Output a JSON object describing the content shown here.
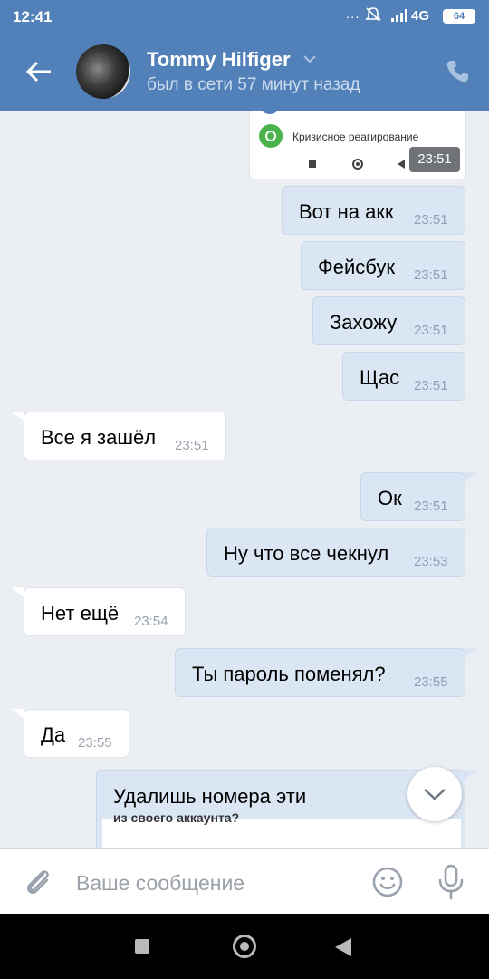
{
  "status_bar": {
    "time": "12:41",
    "dots": "...",
    "network": "4G",
    "battery": "64"
  },
  "header": {
    "contact_name": "Tommy Hilfiger",
    "last_seen": "был в сети 57 минут назад"
  },
  "attachment": {
    "label": "Кризисное реагирование",
    "time": "23:51"
  },
  "messages": [
    {
      "dir": "out",
      "text": "Вот на акк",
      "time": "23:51"
    },
    {
      "dir": "out",
      "text": "Фейсбук",
      "time": "23:51"
    },
    {
      "dir": "out",
      "text": "Захожу",
      "time": "23:51"
    },
    {
      "dir": "out",
      "text": "Щас",
      "time": "23:51"
    },
    {
      "dir": "in",
      "text": "Все я зашёл",
      "time": "23:51"
    },
    {
      "dir": "out",
      "text": "Ок",
      "time": "23:51"
    },
    {
      "dir": "out",
      "text": "Ну что все чекнул",
      "time": "23:53"
    },
    {
      "dir": "in",
      "text": "Нет ещё",
      "time": "23:54"
    },
    {
      "dir": "out",
      "text": "Ты пароль поменял?",
      "time": "23:55"
    },
    {
      "dir": "in",
      "text": "Да",
      "time": "23:55"
    }
  ],
  "last_message": {
    "text": "Удалишь номера эти",
    "quote_fragment": "из своего аккаунта?"
  },
  "composer": {
    "placeholder": "Ваше сообщение"
  },
  "colors": {
    "header": "#5181b8",
    "outgoing": "#dbe6f4",
    "incoming": "#ffffff",
    "background": "#ebeef2"
  }
}
